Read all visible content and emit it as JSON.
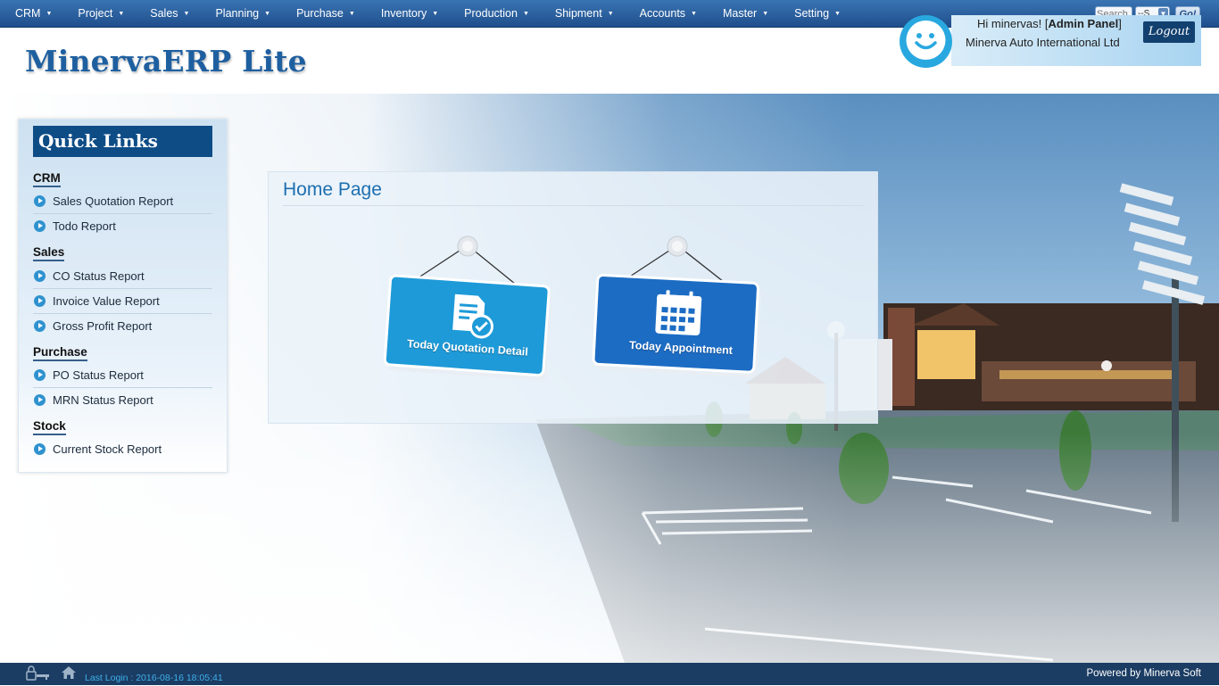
{
  "menu": {
    "items": [
      {
        "label": "CRM"
      },
      {
        "label": "Project"
      },
      {
        "label": "Sales"
      },
      {
        "label": "Planning"
      },
      {
        "label": "Purchase"
      },
      {
        "label": "Inventory"
      },
      {
        "label": "Production"
      },
      {
        "label": "Shipment"
      },
      {
        "label": "Accounts"
      },
      {
        "label": "Master"
      },
      {
        "label": "Setting"
      }
    ],
    "search_placeholder": "Search",
    "search_select_value": "--S",
    "go_label": "Go!"
  },
  "header": {
    "logo": "MinervaERP Lite",
    "greeting_prefix": "Hi minervas! [",
    "greeting_role": "Admin Panel",
    "greeting_suffix": "]",
    "company": "Minerva Auto International Ltd",
    "logout_label": "Logout",
    "avatar_icon": "smiley-chat-icon"
  },
  "sidebar": {
    "title": "Quick Links",
    "sections": [
      {
        "heading": "CRM",
        "links": [
          "Sales Quotation Report",
          "Todo Report"
        ]
      },
      {
        "heading": "Sales",
        "links": [
          "CO Status Report",
          "Invoice Value Report",
          "Gross Profit Report"
        ]
      },
      {
        "heading": "Purchase",
        "links": [
          "PO Status Report",
          "MRN Status Report"
        ]
      },
      {
        "heading": "Stock",
        "links": [
          "Current Stock Report"
        ]
      }
    ]
  },
  "home": {
    "title": "Home Page",
    "tiles": [
      {
        "label": "Today Quotation Detail",
        "icon": "quotation-document-icon",
        "color": "#1e9ad8"
      },
      {
        "label": "Today Appointment",
        "icon": "calendar-icon",
        "color": "#1c6cc4"
      }
    ]
  },
  "footer": {
    "last_login": "Last Login : 2016-08-16 18:05:41",
    "powered_by": "Powered by Minerva Soft"
  },
  "colors": {
    "menu_bar": "#2a5f9e",
    "logo": "#1e5fa0",
    "sidebar_title": "#0e4c86",
    "footer": "#1b3c63",
    "link_icon": "#2f92cf"
  }
}
